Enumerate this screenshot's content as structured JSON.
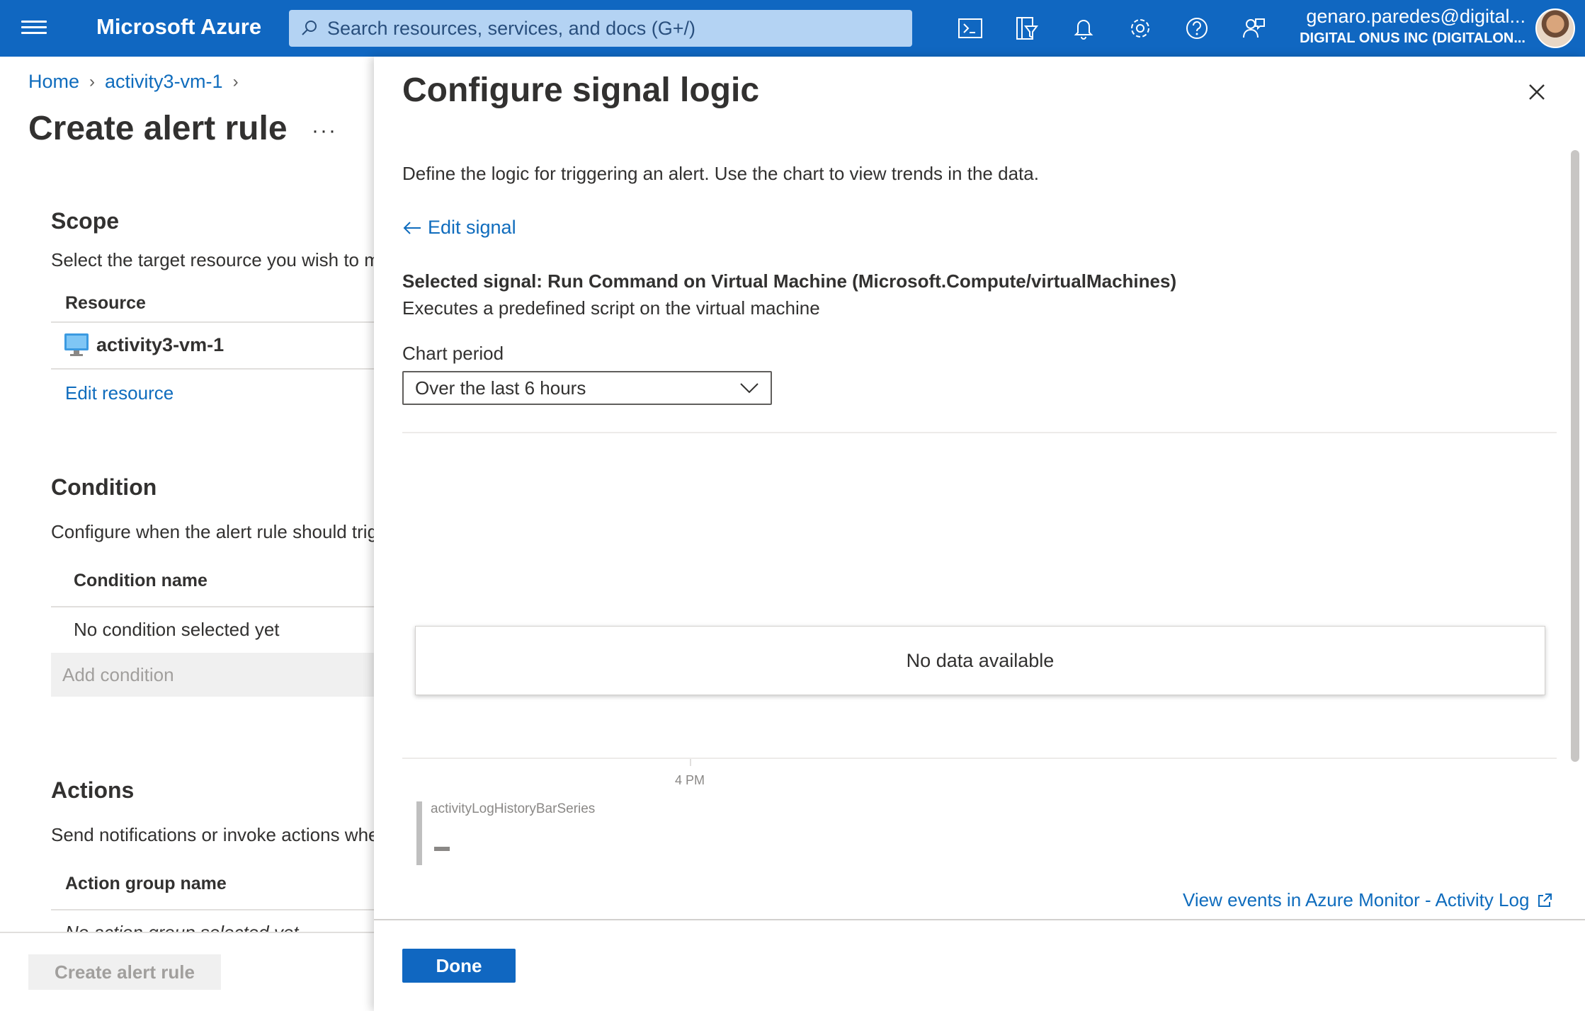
{
  "topbar": {
    "brand": "Microsoft Azure",
    "search_placeholder": "Search resources, services, and docs (G+/)",
    "icons": [
      "cloud-shell-icon",
      "directory-filter-icon",
      "notifications-icon",
      "settings-icon",
      "help-icon",
      "feedback-icon"
    ],
    "user_email": "genaro.paredes@digital...",
    "user_tenant": "DIGITAL ONUS INC (DIGITALON..."
  },
  "breadcrumb": {
    "home": "Home",
    "vm": "activity3-vm-1"
  },
  "left": {
    "title": "Create alert rule",
    "more": "···",
    "scope": {
      "title": "Scope",
      "desc": "Select the target resource you wish to m",
      "col_resource": "Resource",
      "resource_name": "activity3-vm-1",
      "edit_resource": "Edit resource"
    },
    "condition": {
      "title": "Condition",
      "desc": "Configure when the alert rule should trig",
      "col_name": "Condition name",
      "empty": "No condition selected yet",
      "add": "Add condition"
    },
    "actions": {
      "title": "Actions",
      "desc": "Send notifications or invoke actions whe",
      "col_name": "Action group name",
      "empty": "No action group selected yet"
    },
    "create_button": "Create alert rule"
  },
  "panel": {
    "title": "Configure signal logic",
    "description": "Define the logic for triggering an alert. Use the chart to view trends in the data.",
    "edit_signal": "Edit signal",
    "selected_signal": "Selected signal: Run Command on Virtual Machine (Microsoft.Compute/virtualMachines)",
    "signal_desc": "Executes a predefined script on the virtual machine",
    "chart_period_label": "Chart period",
    "chart_period_value": "Over the last 6 hours",
    "no_data": "No data available",
    "tick_label": "4 PM",
    "legend_series": "activityLogHistoryBarSeries",
    "legend_value": "–",
    "monitor_link": "View events in Azure Monitor - Activity Log",
    "done_button": "Done"
  },
  "colors": {
    "accent": "#1067c1",
    "link": "#0f6cbd",
    "search_bg": "#b4d3f3"
  }
}
